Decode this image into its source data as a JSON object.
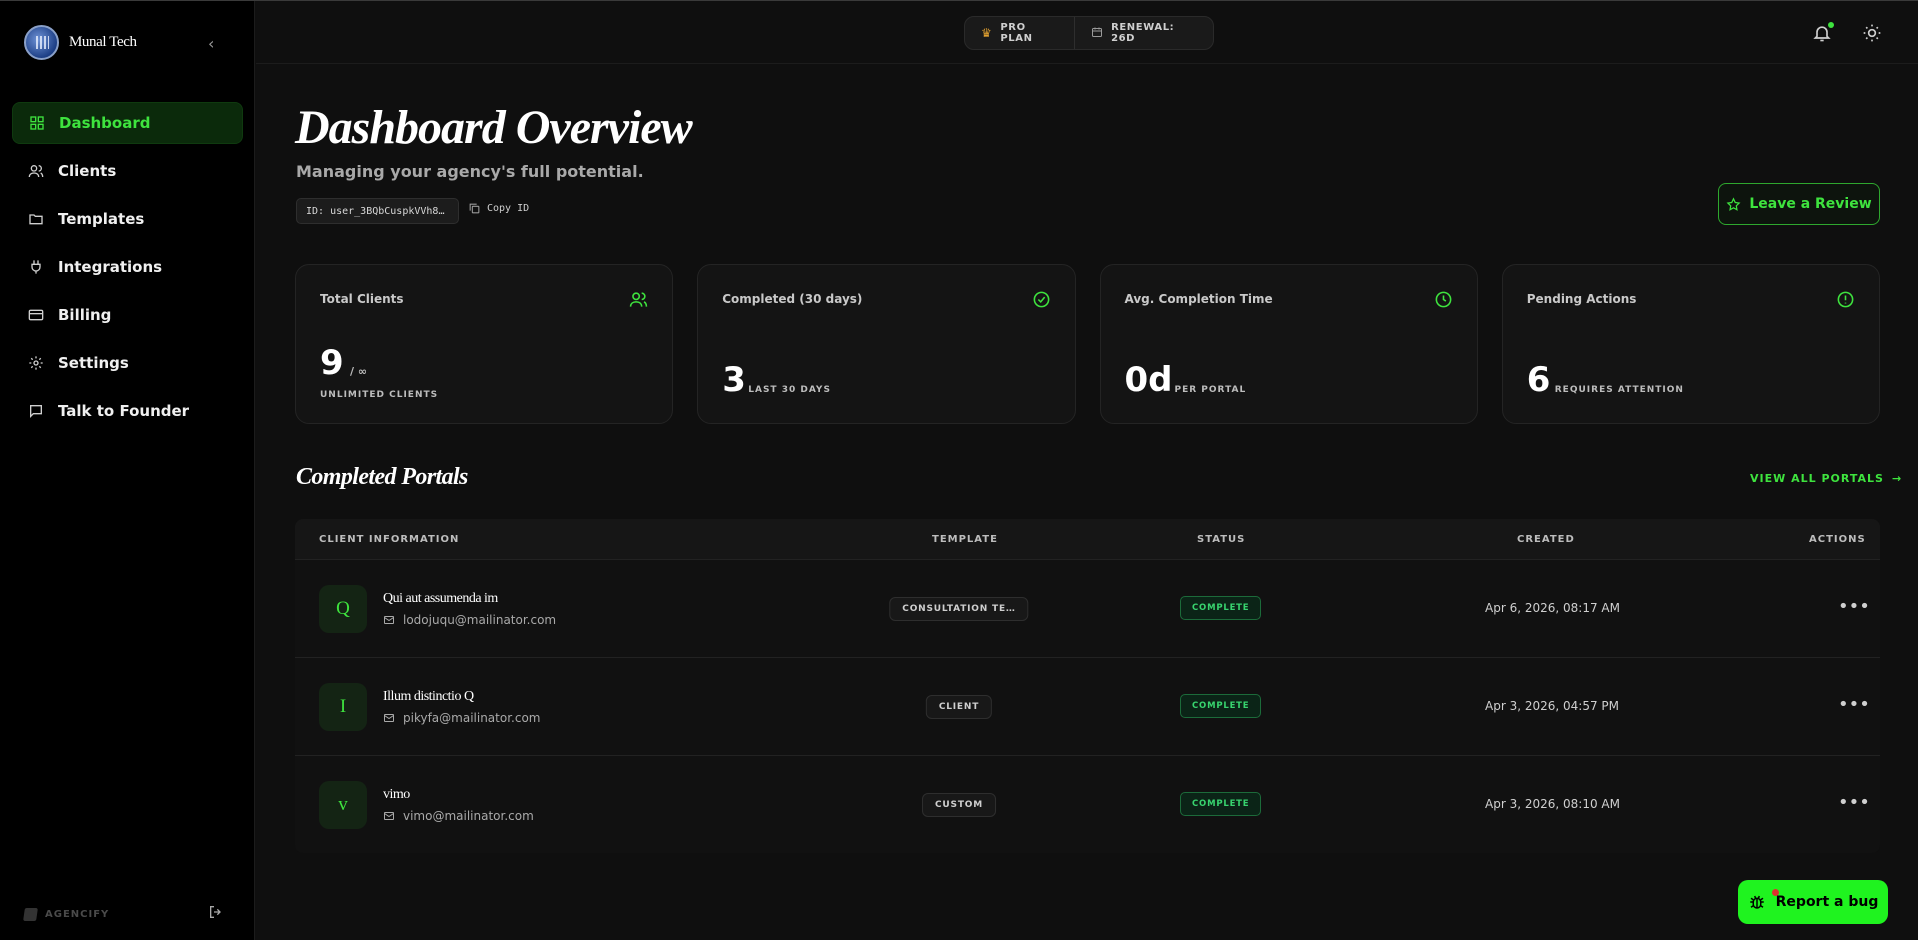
{
  "brand": {
    "name": "Munal Tech",
    "footer": "AGENCIFY"
  },
  "nav": [
    {
      "label": "Dashboard",
      "icon": "grid-icon",
      "active": true
    },
    {
      "label": "Clients",
      "icon": "users-icon"
    },
    {
      "label": "Templates",
      "icon": "folder-icon"
    },
    {
      "label": "Integrations",
      "icon": "plug-icon"
    },
    {
      "label": "Billing",
      "icon": "card-icon"
    },
    {
      "label": "Settings",
      "icon": "gear-icon"
    },
    {
      "label": "Talk to Founder",
      "icon": "chat-icon"
    }
  ],
  "topbar": {
    "plan": "PRO PLAN",
    "renewal": "RENEWAL: 26D"
  },
  "header": {
    "title": "Dashboard Overview",
    "subtitle": "Managing your agency's full potential.",
    "user_id": "ID: user_3BQbCuspkVVh8…",
    "copy_label": "Copy ID",
    "review_label": "Leave a Review"
  },
  "stats": [
    {
      "label": "Total Clients",
      "value": "9",
      "suffix": "/ ∞",
      "sub": "UNLIMITED CLIENTS",
      "icon": "users-icon"
    },
    {
      "label": "Completed (30 days)",
      "value": "3",
      "sub": "LAST 30 DAYS",
      "icon": "check-circle-icon"
    },
    {
      "label": "Avg. Completion Time",
      "value": "0d",
      "sub": "PER PORTAL",
      "icon": "clock-icon"
    },
    {
      "label": "Pending Actions",
      "value": "6",
      "sub": "REQUIRES ATTENTION",
      "icon": "alert-circle-icon"
    }
  ],
  "portals": {
    "title": "Completed Portals",
    "view_all": "VIEW ALL PORTALS",
    "columns": [
      "CLIENT INFORMATION",
      "TEMPLATE",
      "STATUS",
      "CREATED",
      "ACTIONS"
    ],
    "rows": [
      {
        "initial": "Q",
        "name": "Qui aut assumenda im",
        "email": "lodojuqu@mailinator.com",
        "template": "CONSULTATION TE…",
        "status": "COMPLETE",
        "created": "Apr 6, 2026, 08:17 AM"
      },
      {
        "initial": "I",
        "name": "Illum distinctio Q",
        "email": "pikyfa@mailinator.com",
        "template": "CLIENT",
        "status": "COMPLETE",
        "created": "Apr 3, 2026, 04:57 PM"
      },
      {
        "initial": "v",
        "name": "vimo",
        "email": "vimo@mailinator.com",
        "template": "CUSTOM",
        "status": "COMPLETE",
        "created": "Apr 3, 2026, 08:10 AM"
      }
    ]
  },
  "bug_button": "Report a bug",
  "colors": {
    "accent": "#3ee33e",
    "bg": "#0f0f0f",
    "sidebar": "#000000"
  }
}
